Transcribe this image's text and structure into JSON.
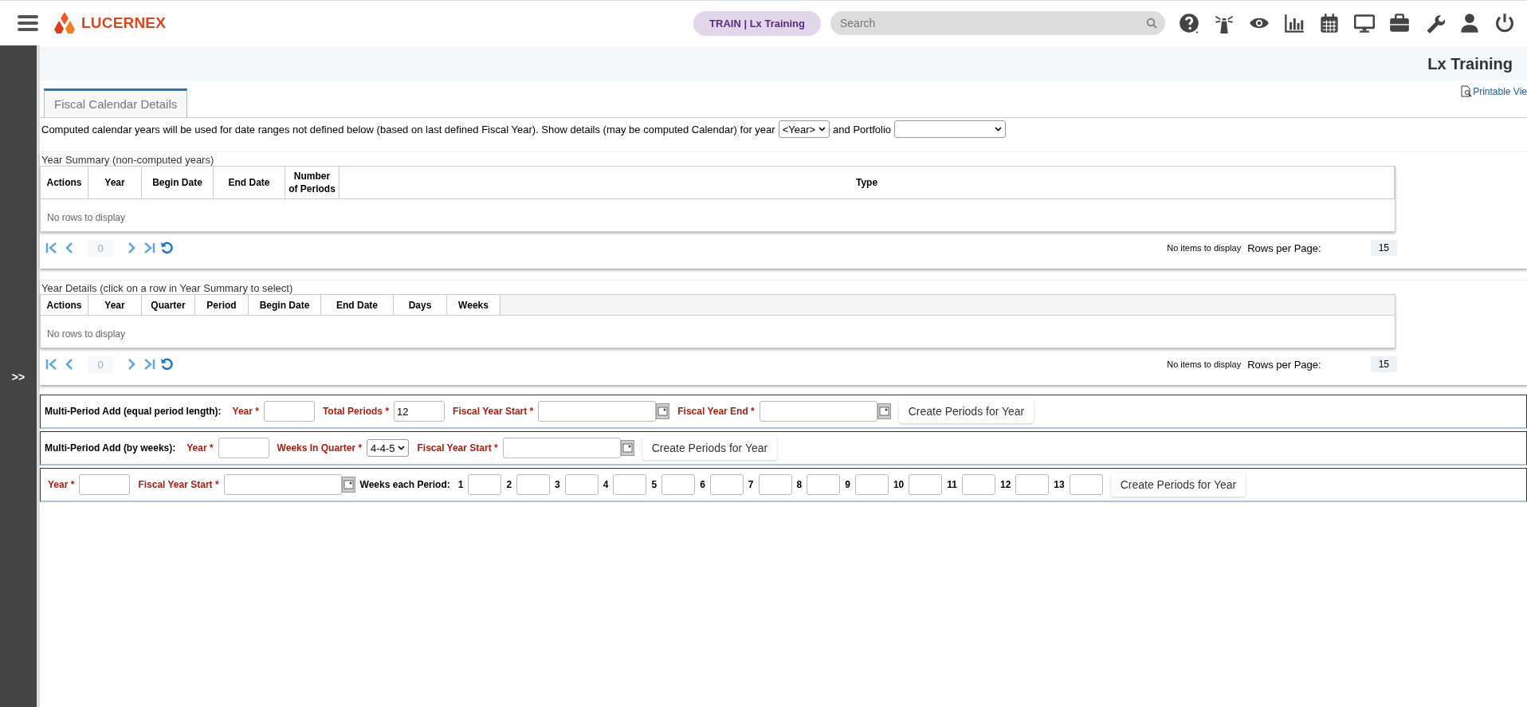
{
  "header": {
    "logo": "LUCERNEX",
    "environment": "TRAIN | Lx Training",
    "search": {
      "placeholder": "Search"
    }
  },
  "sidebar": {
    "toggle": ">>"
  },
  "page_title": "Lx Training",
  "printable_view": "Printable Vie",
  "tabs": [
    {
      "label": "Fiscal Calendar Details",
      "selected": true
    }
  ],
  "intro": {
    "text": "Computed calendar years will be used for date ranges not defined below (based on last defined Fiscal Year).  Show details (may be computed Calendar) for year",
    "year_select": "<Year>",
    "portfolio_label": "and Portfolio"
  },
  "grids": [
    {
      "title": "Year Summary (non-computed years)",
      "columns": [
        "Actions",
        "Year",
        "Begin Date",
        "End Date",
        "Number of Periods",
        "Type"
      ],
      "empty": "No rows to display",
      "page": "0",
      "status": "No items to display",
      "rows_per_page_label": "Rows per Page:",
      "rows_per_page": "15"
    },
    {
      "title": "Year Details (click on a row in Year Summary to select)",
      "columns": [
        "Actions",
        "Year",
        "Quarter",
        "Period",
        "Begin Date",
        "End Date",
        "Days",
        "Weeks"
      ],
      "empty": "No rows to display",
      "page": "0",
      "status": "No items to display",
      "rows_per_page_label": "Rows per Page:",
      "rows_per_page": "15"
    }
  ],
  "forms": [
    {
      "items": [
        {
          "kind": "heading",
          "text": "Multi-Period Add (equal period length):"
        },
        {
          "kind": "label",
          "text": "Year *"
        },
        {
          "kind": "input"
        },
        {
          "kind": "label",
          "text": "Total Periods *"
        },
        {
          "kind": "input",
          "value": "12"
        },
        {
          "kind": "label",
          "text": "Fiscal Year Start *"
        },
        {
          "kind": "date"
        },
        {
          "kind": "label",
          "text": "Fiscal Year End *"
        },
        {
          "kind": "date"
        },
        {
          "kind": "button",
          "text": "Create Periods for Year"
        }
      ]
    },
    {
      "items": [
        {
          "kind": "heading",
          "text": "Multi-Period Add (by weeks):"
        },
        {
          "kind": "label",
          "text": "Year *"
        },
        {
          "kind": "input"
        },
        {
          "kind": "label",
          "text": "Weeks In Quarter *"
        },
        {
          "kind": "select",
          "value": "4-4-5"
        },
        {
          "kind": "label",
          "text": "Fiscal Year Start *"
        },
        {
          "kind": "date"
        },
        {
          "kind": "button",
          "text": "Create Periods for Year"
        }
      ]
    },
    {
      "items": [
        {
          "kind": "label",
          "text": "Year *"
        },
        {
          "kind": "input"
        },
        {
          "kind": "label",
          "text": "Fiscal Year Start *"
        },
        {
          "kind": "date"
        },
        {
          "kind": "heading",
          "text": "Weeks each Period:"
        },
        {
          "kind": "index",
          "text": "1"
        },
        {
          "kind": "small-input"
        },
        {
          "kind": "index",
          "text": "2"
        },
        {
          "kind": "small-input"
        },
        {
          "kind": "index",
          "text": "3"
        },
        {
          "kind": "small-input"
        },
        {
          "kind": "index",
          "text": "4"
        },
        {
          "kind": "small-input"
        },
        {
          "kind": "index",
          "text": "5"
        },
        {
          "kind": "small-input"
        },
        {
          "kind": "index",
          "text": "6"
        },
        {
          "kind": "small-input"
        },
        {
          "kind": "index",
          "text": "7"
        },
        {
          "kind": "small-input"
        },
        {
          "kind": "index",
          "text": "8"
        },
        {
          "kind": "small-input"
        },
        {
          "kind": "index",
          "text": "9"
        },
        {
          "kind": "small-input"
        },
        {
          "kind": "index",
          "text": "10"
        },
        {
          "kind": "small-input"
        },
        {
          "kind": "index",
          "text": "11"
        },
        {
          "kind": "small-input"
        },
        {
          "kind": "index",
          "text": "12"
        },
        {
          "kind": "small-input"
        },
        {
          "kind": "index",
          "text": "13"
        },
        {
          "kind": "small-input"
        },
        {
          "kind": "button",
          "text": "Create Periods for Year"
        }
      ]
    }
  ]
}
